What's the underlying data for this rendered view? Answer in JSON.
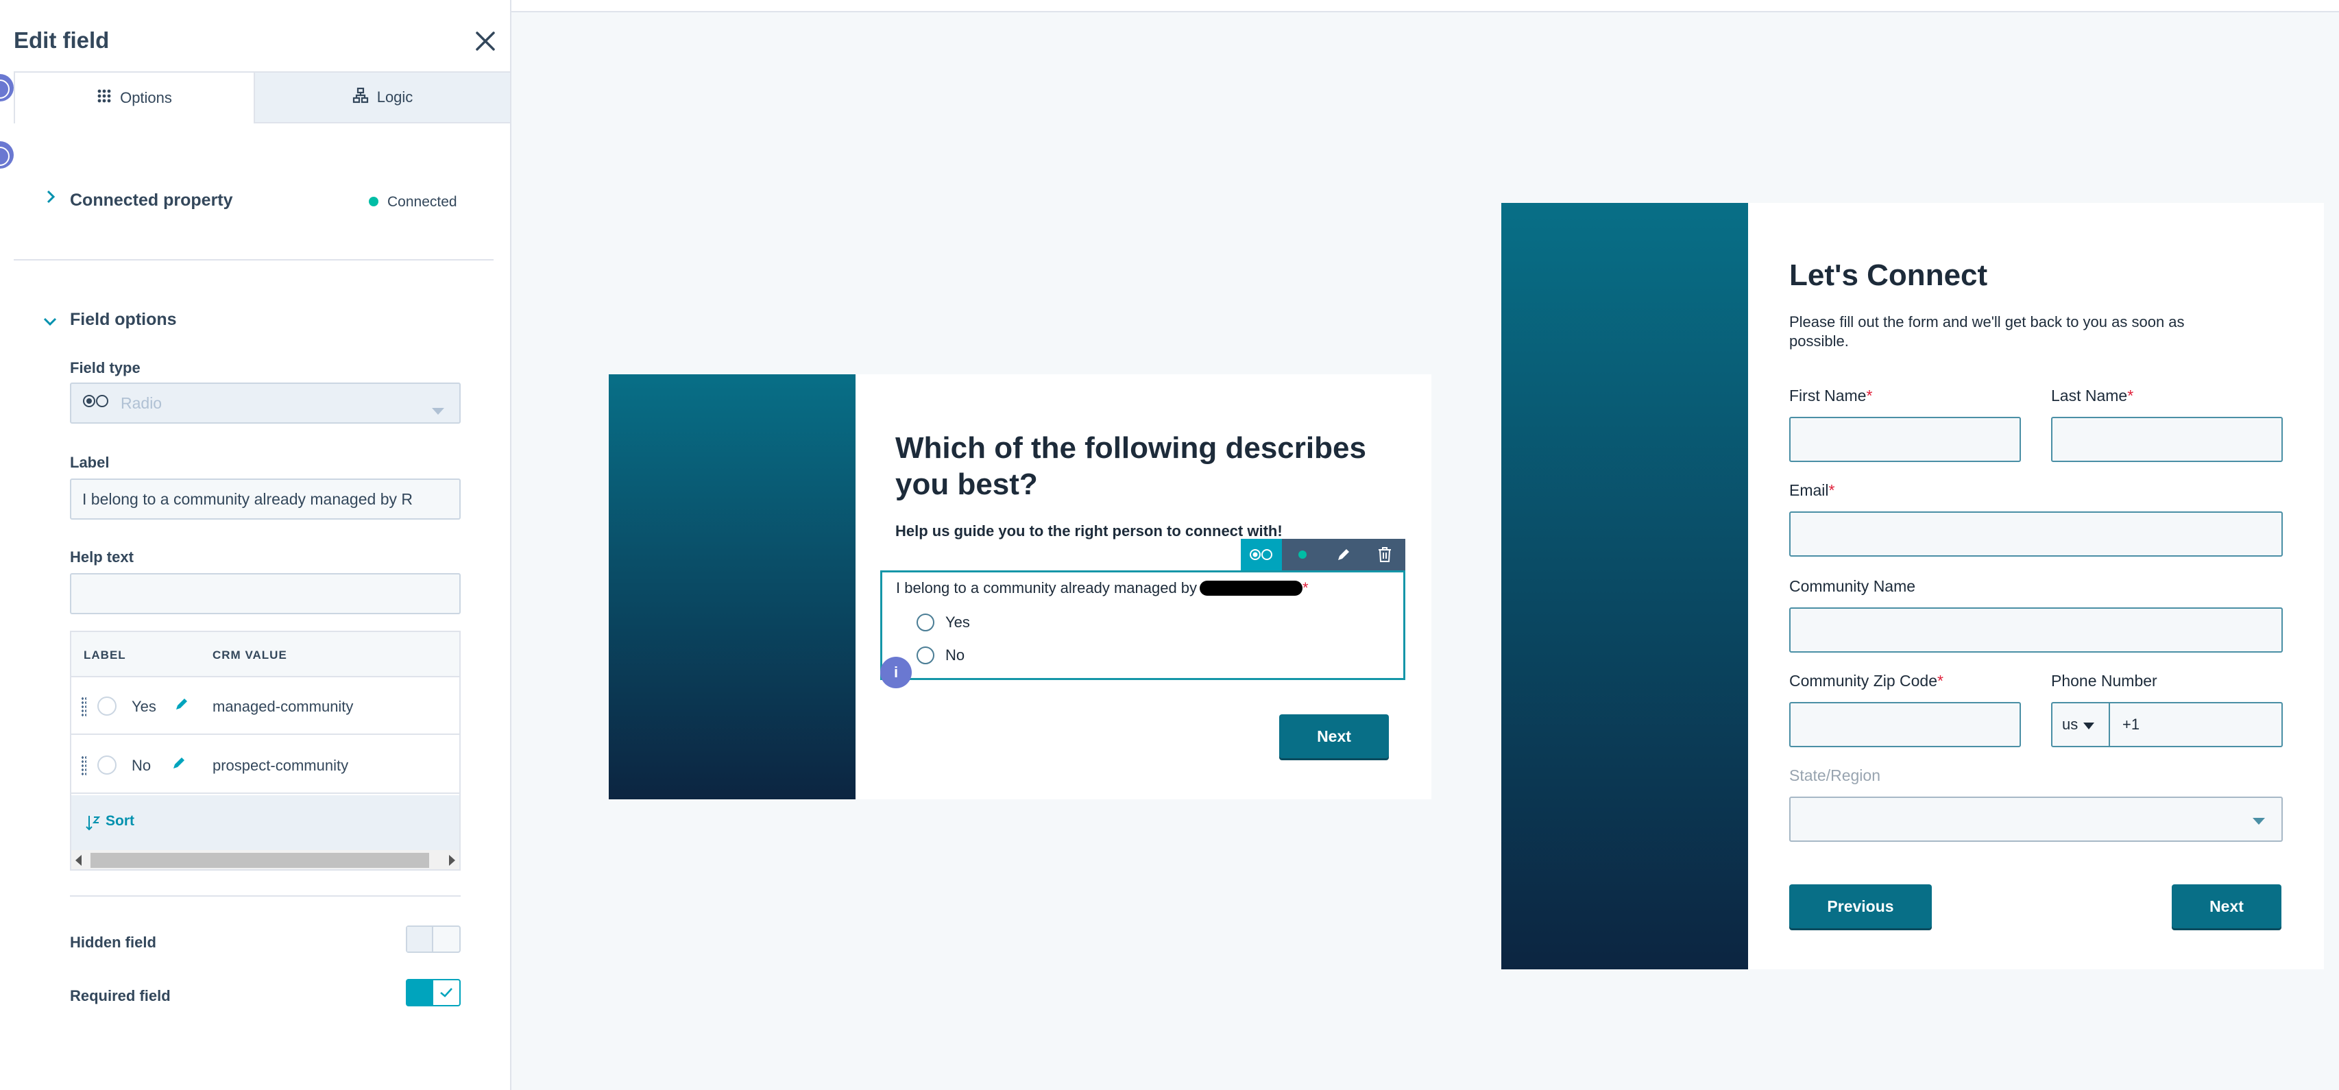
{
  "panel": {
    "title": "Edit field",
    "tabs": [
      {
        "label": "Options",
        "icon": "grid-icon",
        "active": true
      },
      {
        "label": "Logic",
        "icon": "hierarchy-icon",
        "active": false
      }
    ],
    "connected_property": {
      "heading": "Connected property",
      "status": "Connected",
      "status_color": "#00bda5"
    },
    "field_options": {
      "heading": "Field options",
      "field_type_label": "Field type",
      "field_type_value": "Radio",
      "label_label": "Label",
      "label_value": "I belong to a community already managed by R",
      "help_text_label": "Help text",
      "help_text_value": "",
      "table": {
        "columns": [
          "LABEL",
          "CRM VALUE"
        ],
        "rows": [
          {
            "label": "Yes",
            "crm_value": "managed-community"
          },
          {
            "label": "No",
            "crm_value": "prospect-community"
          }
        ],
        "sort_label": "Sort"
      },
      "hidden_field_label": "Hidden field",
      "hidden_field_on": false,
      "required_field_label": "Required field",
      "required_field_on": true
    }
  },
  "form_step_1": {
    "heading": "Which of the following describes you best?",
    "subheading": "Help us guide you to the right person to connect with!",
    "question": "I belong to a community already managed by",
    "required_mark": "*",
    "options": [
      "Yes",
      "No"
    ],
    "next_label": "Next",
    "info_badge": "i"
  },
  "form_step_2": {
    "heading": "Let's Connect",
    "description": "Please fill out the form and we'll get back to you as soon as possible.",
    "first_name_label": "First Name",
    "last_name_label": "Last Name",
    "email_label": "Email",
    "community_name_label": "Community Name",
    "zip_label": "Community Zip Code",
    "phone_label": "Phone Number",
    "phone_country": "us",
    "phone_prefix": "+1",
    "state_label": "State/Region",
    "required_mark": "*",
    "previous_label": "Previous",
    "next_label": "Next"
  },
  "colors": {
    "accent": "#00a4bd",
    "brand_dark": "#086f87",
    "gradient_bottom": "#0c2541",
    "info_badge": "#6a78d1"
  }
}
